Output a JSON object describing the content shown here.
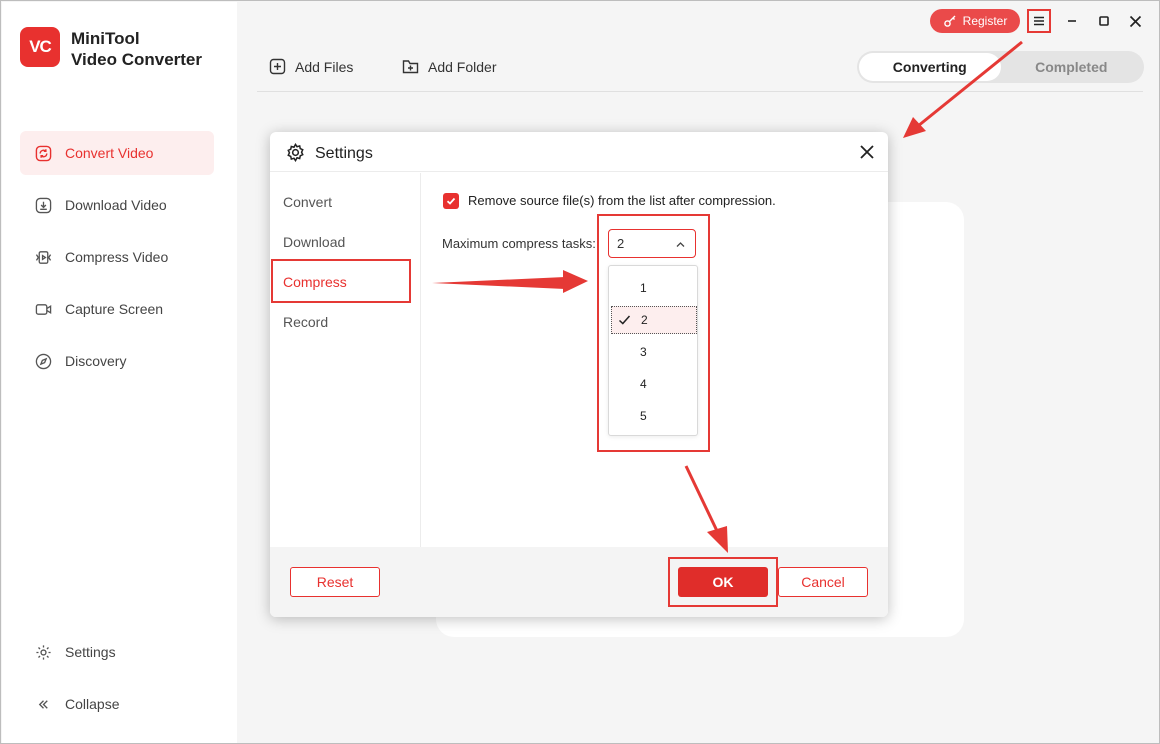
{
  "app": {
    "logo_text": "VC",
    "title_line1": "MiniTool",
    "title_line2": "Video Converter"
  },
  "sidebar": {
    "items": [
      {
        "label": "Convert Video",
        "icon": "convert-icon",
        "active": true
      },
      {
        "label": "Download Video",
        "icon": "download-icon",
        "active": false
      },
      {
        "label": "Compress Video",
        "icon": "compress-icon",
        "active": false
      },
      {
        "label": "Capture Screen",
        "icon": "camera-icon",
        "active": false
      },
      {
        "label": "Discovery",
        "icon": "compass-icon",
        "active": false
      }
    ],
    "bottom": [
      {
        "label": "Settings",
        "icon": "gear-icon"
      },
      {
        "label": "Collapse",
        "icon": "double-chevron-left-icon"
      }
    ]
  },
  "toolbar": {
    "register_label": "Register",
    "add_files_label": "Add Files",
    "add_folder_label": "Add Folder",
    "tabs": [
      {
        "label": "Converting",
        "active": true
      },
      {
        "label": "Completed",
        "active": false
      }
    ]
  },
  "dialog": {
    "title": "Settings",
    "menu": [
      {
        "label": "Convert",
        "active": false
      },
      {
        "label": "Download",
        "active": false
      },
      {
        "label": "Compress",
        "active": true
      },
      {
        "label": "Record",
        "active": false
      }
    ],
    "remove_source_label": "Remove source file(s) from the list after compression.",
    "remove_source_checked": true,
    "max_tasks_label": "Maximum compress tasks:",
    "max_tasks_value": "2",
    "max_tasks_options": [
      "1",
      "2",
      "3",
      "4",
      "5"
    ],
    "reset_label": "Reset",
    "ok_label": "OK",
    "cancel_label": "Cancel"
  },
  "colors": {
    "accent": "#e8312f",
    "annotation": "#e53935"
  }
}
